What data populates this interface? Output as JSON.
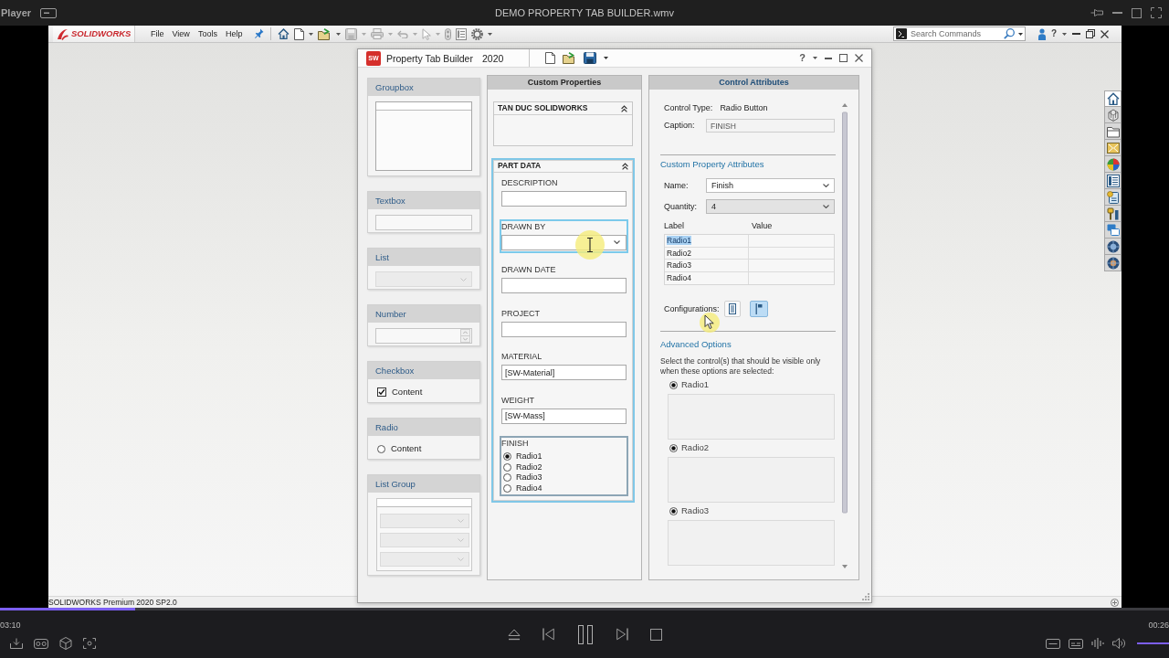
{
  "player": {
    "label": "Player",
    "title": "DEMO PROPERTY TAB BUILDER.wmv",
    "progress": {
      "level": 0.116
    },
    "elapsed": "03:10",
    "duration": "00:26",
    "volume": {
      "level": 1
    }
  },
  "app": {
    "logo": "SOLIDWORKS",
    "menu": [
      "File",
      "View",
      "Tools",
      "Help"
    ],
    "search": {
      "placeholder": "Search Commands"
    },
    "help": "?",
    "task_pane": [
      {
        "kind": "home",
        "selected": true
      },
      {
        "kind": "parts",
        "selected": false
      },
      {
        "kind": "folder",
        "selected": false
      },
      {
        "kind": "views",
        "selected": false
      },
      {
        "kind": "appearances",
        "selected": false
      },
      {
        "kind": "properties",
        "selected": false
      },
      {
        "kind": "library",
        "selected": false
      },
      {
        "kind": "tools",
        "selected": false
      },
      {
        "kind": "forum",
        "selected": false
      },
      {
        "kind": "globe",
        "selected": false
      },
      {
        "kind": "globe2",
        "selected": false
      }
    ],
    "status_bar": "SOLIDWORKS Premium 2020 SP2.0"
  },
  "builder": {
    "icon": "SW",
    "title": "Property Tab Builder",
    "version": "2020",
    "help": "?",
    "palette": [
      {
        "kind": "groupbox",
        "label": "Groupbox"
      },
      {
        "kind": "textbox",
        "label": "Textbox"
      },
      {
        "kind": "list",
        "label": "List"
      },
      {
        "kind": "number",
        "label": "Number"
      },
      {
        "kind": "checkbox",
        "label": "Checkbox",
        "content": "Content",
        "checked": true
      },
      {
        "kind": "radio",
        "label": "Radio",
        "content": "Content",
        "checked": false
      },
      {
        "kind": "listgroup",
        "label": "List Group"
      }
    ],
    "custom_properties": {
      "title": "Custom Properties",
      "groups": [
        {
          "title": "TAN DUC SOLIDWORKS",
          "selected": false
        },
        {
          "title": "PART DATA",
          "selected": true,
          "controls": [
            {
              "kind": "textbox",
              "label": "DESCRIPTION",
              "hovered": false,
              "selected": false
            },
            {
              "kind": "list",
              "label": "DRAWN BY",
              "hovered": true,
              "selected": false
            },
            {
              "kind": "textbox",
              "label": "DRAWN DATE",
              "hovered": false,
              "selected": false
            },
            {
              "kind": "textbox",
              "label": "PROJECT",
              "hovered": false,
              "selected": false
            },
            {
              "kind": "textbox",
              "label": "MATERIAL",
              "value": "[SW-Material]",
              "hovered": false,
              "selected": false
            },
            {
              "kind": "textbox",
              "label": "WEIGHT",
              "value": "[SW-Mass]",
              "hovered": false,
              "selected": false
            },
            {
              "kind": "radio",
              "label": "FINISH",
              "hovered": false,
              "selected": true,
              "options": [
                {
                  "label": "Radio1",
                  "selected": true
                },
                {
                  "label": "Radio2",
                  "selected": false
                },
                {
                  "label": "Radio3",
                  "selected": false
                },
                {
                  "label": "Radio4",
                  "selected": false
                }
              ]
            }
          ]
        }
      ]
    },
    "control_attributes": {
      "title": "Control Attributes",
      "type_label": "Control Type:",
      "type": "Radio Button",
      "caption_label": "Caption:",
      "caption": "FINISH",
      "property_heading": "Custom Property Attributes",
      "name_label": "Name:",
      "name": "Finish",
      "quantity_label": "Quantity:",
      "quantity": "4",
      "table": {
        "columns": [
          "Label",
          "Value"
        ],
        "rows": [
          {
            "label": "Radio1",
            "selected": true
          },
          {
            "label": "Radio2",
            "selected": false
          },
          {
            "label": "Radio3",
            "selected": false
          },
          {
            "label": "Radio4",
            "selected": false
          }
        ]
      },
      "configurations_label": "Configurations:",
      "configuration_buttons": [
        {
          "kind": "list",
          "selected": false
        },
        {
          "kind": "single",
          "selected": true
        }
      ],
      "advanced_heading": "Advanced Options",
      "advanced_hint": "Select the control(s) that should be visible only when these options are selected:",
      "advanced_options": [
        {
          "label": "Radio1",
          "selected": true
        },
        {
          "label": "Radio2",
          "selected": true
        },
        {
          "label": "Radio3",
          "selected": true
        }
      ]
    }
  }
}
